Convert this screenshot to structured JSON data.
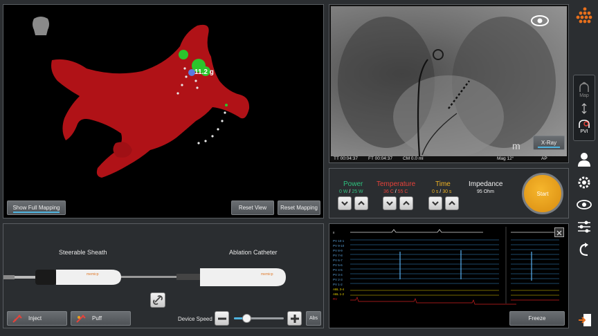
{
  "map": {
    "force_label": "11.2 g",
    "show_full_mapping": "Show Full Mapping",
    "reset_view": "Reset View",
    "reset_mapping": "Reset Mapping"
  },
  "xray": {
    "tt": "TT 00:04:37",
    "ft": "FT 00:04:37",
    "cm": "CM 0.0 ml",
    "mag": "Mag 12°",
    "view": "AP",
    "button": "X-Ray",
    "watermark": "m"
  },
  "ablation": {
    "power_title": "Power",
    "power_value": "0 W",
    "power_target": "25 W",
    "temp_title": "Temperature",
    "temp_value": "36 C",
    "temp_target": "55 C",
    "time_title": "Time",
    "time_value": "0 s",
    "time_target": "30 s",
    "impedance_title": "Impedance",
    "impedance_value": "95 Ohm",
    "start": "Start",
    "slash": "/",
    "colors": {
      "power": "#2ec27e",
      "temperature": "#e8423a",
      "time": "#f0b323",
      "start": "#e8a11c"
    }
  },
  "devices": {
    "sheath_title": "Steerable Sheath",
    "catheter_title": "Ablation Catheter",
    "sheath_brand": "memicp",
    "catheter_brand": "memicp",
    "inject": "Inject",
    "puff": "Puff",
    "device_speed": "Device Speed",
    "abs": "Abs",
    "speed_level": 0.25
  },
  "ecg": {
    "freeze": "Freeze",
    "top_label": "II",
    "labels": [
      "PV 10-1",
      "PV 9-10",
      "PV 8-9",
      "PV 7-8",
      "PV 6-7",
      "PV 5-6",
      "PV 4-5",
      "PV 3-4",
      "PV 2-3",
      "PV 1-2",
      "ABL 3-4",
      "ABL 1-2",
      "RV"
    ]
  },
  "sidebar": {
    "map": "Map",
    "pvi": "PVI"
  }
}
